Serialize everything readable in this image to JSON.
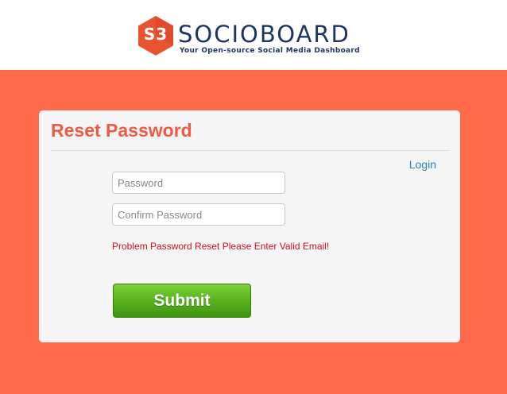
{
  "brand": {
    "logo_mark": "S3",
    "name": "SOCIOBOARD",
    "tagline": "Your Open-source Social Media Dashboard",
    "hex_color": "#e9532f",
    "name_color": "#1e3563"
  },
  "colors": {
    "page_background": "#ff6b4a",
    "title": "#ee5a43",
    "link": "#2a7fbf",
    "error": "#cc1122",
    "button": "#5cb51f"
  },
  "form": {
    "title": "Reset Password",
    "login_link": "Login",
    "password_placeholder": "Password",
    "confirm_placeholder": "Confirm Password",
    "password_value": "",
    "confirm_value": "",
    "error_message": "Problem Password Reset Please Enter Valid Email!",
    "submit_label": "Submit"
  }
}
